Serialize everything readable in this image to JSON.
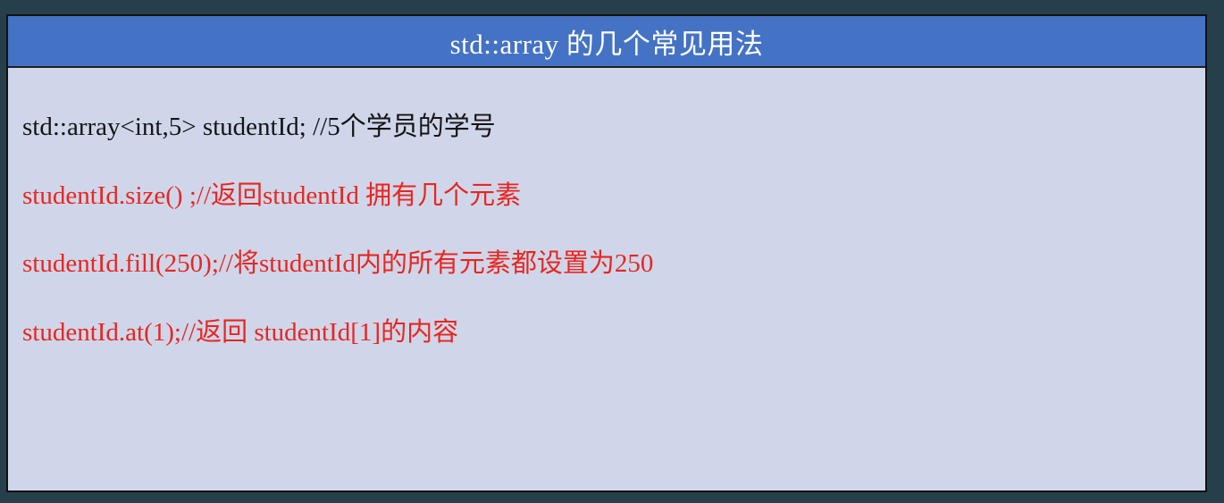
{
  "slide": {
    "title": "std::array 的几个常见用法",
    "lines": [
      {
        "text": "std::array<int,5> studentId; //5个学员的学号",
        "color": "#141414"
      },
      {
        "text": "studentId.size() ;//返回studentId 拥有几个元素",
        "color": "#e8261f"
      },
      {
        "text": "studentId.fill(250);//将studentId内的所有元素都设置为250",
        "color": "#e8261f"
      },
      {
        "text": "studentId.at(1);//返回 studentId[1]的内容",
        "color": "#e8261f"
      }
    ]
  },
  "colors": {
    "background": "#25404a",
    "title_bar": "#4472c4",
    "panel": "#d0d6ea",
    "title_text": "#ffffff",
    "code_black": "#141414",
    "code_red": "#e8261f"
  }
}
